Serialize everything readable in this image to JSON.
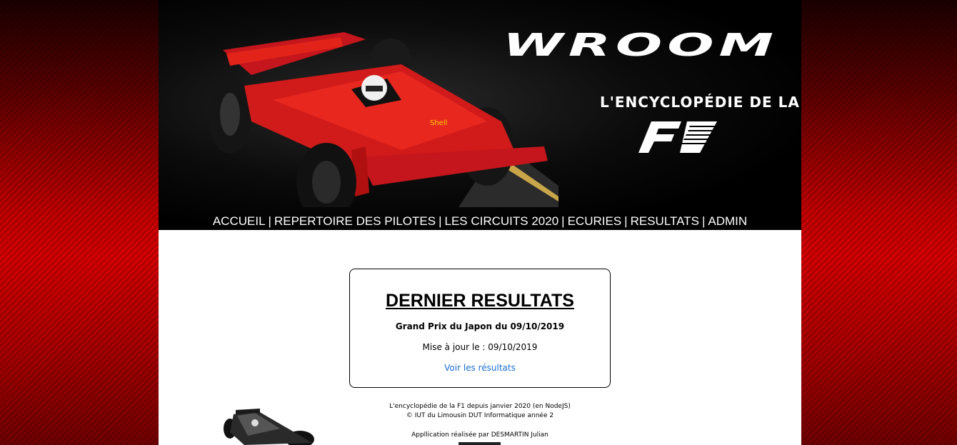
{
  "header": {
    "logo_text": "WROOM",
    "tagline": "L'ENCYCLOPÉDIE DE LA",
    "f1_logo_text": "F1"
  },
  "nav": {
    "items": [
      {
        "label": "ACCUEIL"
      },
      {
        "label": "REPERTOIRE DES PILOTES"
      },
      {
        "label": "LES CIRCUITS 2020"
      },
      {
        "label": "ECURIES"
      },
      {
        "label": "RESULTATS"
      },
      {
        "label": "ADMIN"
      }
    ],
    "separator": "|"
  },
  "latest_results": {
    "title": "DERNIER RESULTATS",
    "grand_prix": "Grand Prix du Japon du 09/10/2019",
    "updated": "Mise à jour le : 09/10/2019",
    "link_label": "Voir les résultats"
  },
  "footer": {
    "line1": "L'encyclopédie de la F1 depuis janvier 2020 (en NodeJS)",
    "line2": "© IUT du Limousin DUT Informatique année 2",
    "author": "Appllication réalisée par DESMARTIN Julian"
  },
  "colors": {
    "background_red": "#c00000",
    "banner_black": "#000000",
    "link_blue": "#1a6fd8"
  }
}
